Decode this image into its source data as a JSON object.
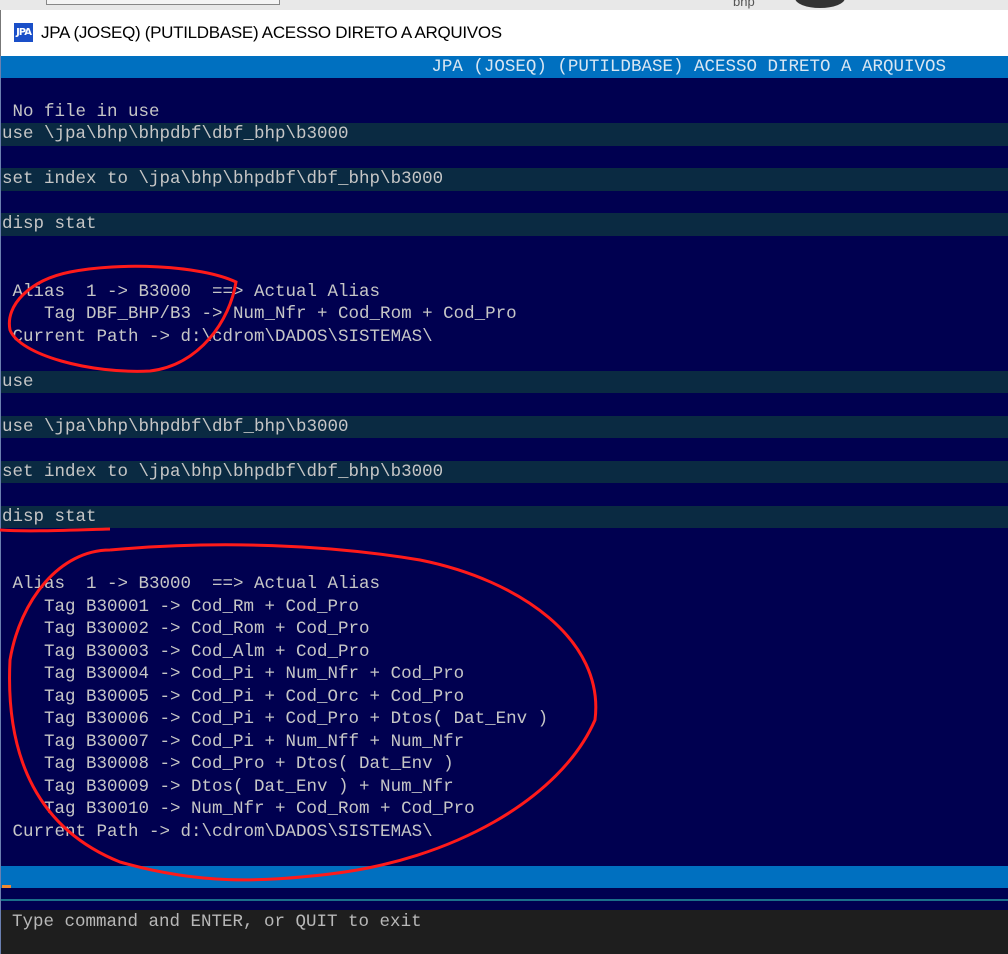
{
  "desktop": {
    "partial_text": "bhp"
  },
  "window": {
    "icon_text": "JPA",
    "title": "JPA (JOSEQ) (PUTILDBASE) ACESSO DIRETO A ARQUIVOS"
  },
  "terminal": {
    "header": "JPA (JOSEQ) (PUTILDBASE) ACESSO DIRETO A ARQUIVOS",
    "lines": [
      {
        "text": "",
        "hl": false
      },
      {
        "text": " No file in use",
        "hl": false
      },
      {
        "text": "use \\jpa\\bhp\\bhpdbf\\dbf_bhp\\b3000",
        "hl": true
      },
      {
        "text": "",
        "hl": false
      },
      {
        "text": "set index to \\jpa\\bhp\\bhpdbf\\dbf_bhp\\b3000",
        "hl": true
      },
      {
        "text": "",
        "hl": false
      },
      {
        "text": "disp stat",
        "hl": true
      },
      {
        "text": "",
        "hl": false
      },
      {
        "text": "",
        "hl": false
      },
      {
        "text": " Alias  1 -> B3000  ==> Actual Alias",
        "hl": false
      },
      {
        "text": "    Tag DBF_BHP/B3 -> Num_Nfr + Cod_Rom + Cod_Pro",
        "hl": false
      },
      {
        "text": " Current Path -> d:\\cdrom\\DADOS\\SISTEMAS\\",
        "hl": false
      },
      {
        "text": "",
        "hl": false
      },
      {
        "text": "use",
        "hl": true
      },
      {
        "text": "",
        "hl": false
      },
      {
        "text": "use \\jpa\\bhp\\bhpdbf\\dbf_bhp\\b3000",
        "hl": true
      },
      {
        "text": "",
        "hl": false
      },
      {
        "text": "set index to \\jpa\\bhp\\bhpdbf\\dbf_bhp\\b3000",
        "hl": true
      },
      {
        "text": "",
        "hl": false
      },
      {
        "text": "disp stat",
        "hl": true
      },
      {
        "text": "",
        "hl": false
      },
      {
        "text": "",
        "hl": false
      },
      {
        "text": " Alias  1 -> B3000  ==> Actual Alias",
        "hl": false
      },
      {
        "text": "    Tag B30001 -> Cod_Rm + Cod_Pro",
        "hl": false
      },
      {
        "text": "    Tag B30002 -> Cod_Rom + Cod_Pro",
        "hl": false
      },
      {
        "text": "    Tag B30003 -> Cod_Alm + Cod_Pro",
        "hl": false
      },
      {
        "text": "    Tag B30004 -> Cod_Pi + Num_Nfr + Cod_Pro",
        "hl": false
      },
      {
        "text": "    Tag B30005 -> Cod_Pi + Cod_Orc + Cod_Pro",
        "hl": false
      },
      {
        "text": "    Tag B30006 -> Cod_Pi + Cod_Pro + Dtos( Dat_Env )",
        "hl": false
      },
      {
        "text": "    Tag B30007 -> Cod_Pi + Num_Nff + Num_Nfr",
        "hl": false
      },
      {
        "text": "    Tag B30008 -> Cod_Pro + Dtos( Dat_Env )",
        "hl": false
      },
      {
        "text": "    Tag B30009 -> Dtos( Dat_Env ) + Num_Nfr",
        "hl": false
      },
      {
        "text": "    Tag B30010 -> Num_Nfr + Cod_Rom + Cod_Pro",
        "hl": false
      },
      {
        "text": " Current Path -> d:\\cdrom\\DADOS\\SISTEMAS\\",
        "hl": false
      },
      {
        "text": "",
        "hl": false
      }
    ],
    "prompt": "Type command and ENTER, or QUIT to exit"
  },
  "colors": {
    "background": "#000050",
    "header": "#0070c0",
    "highlight": "#0a2a42",
    "annotation": "#ff1a1a"
  }
}
